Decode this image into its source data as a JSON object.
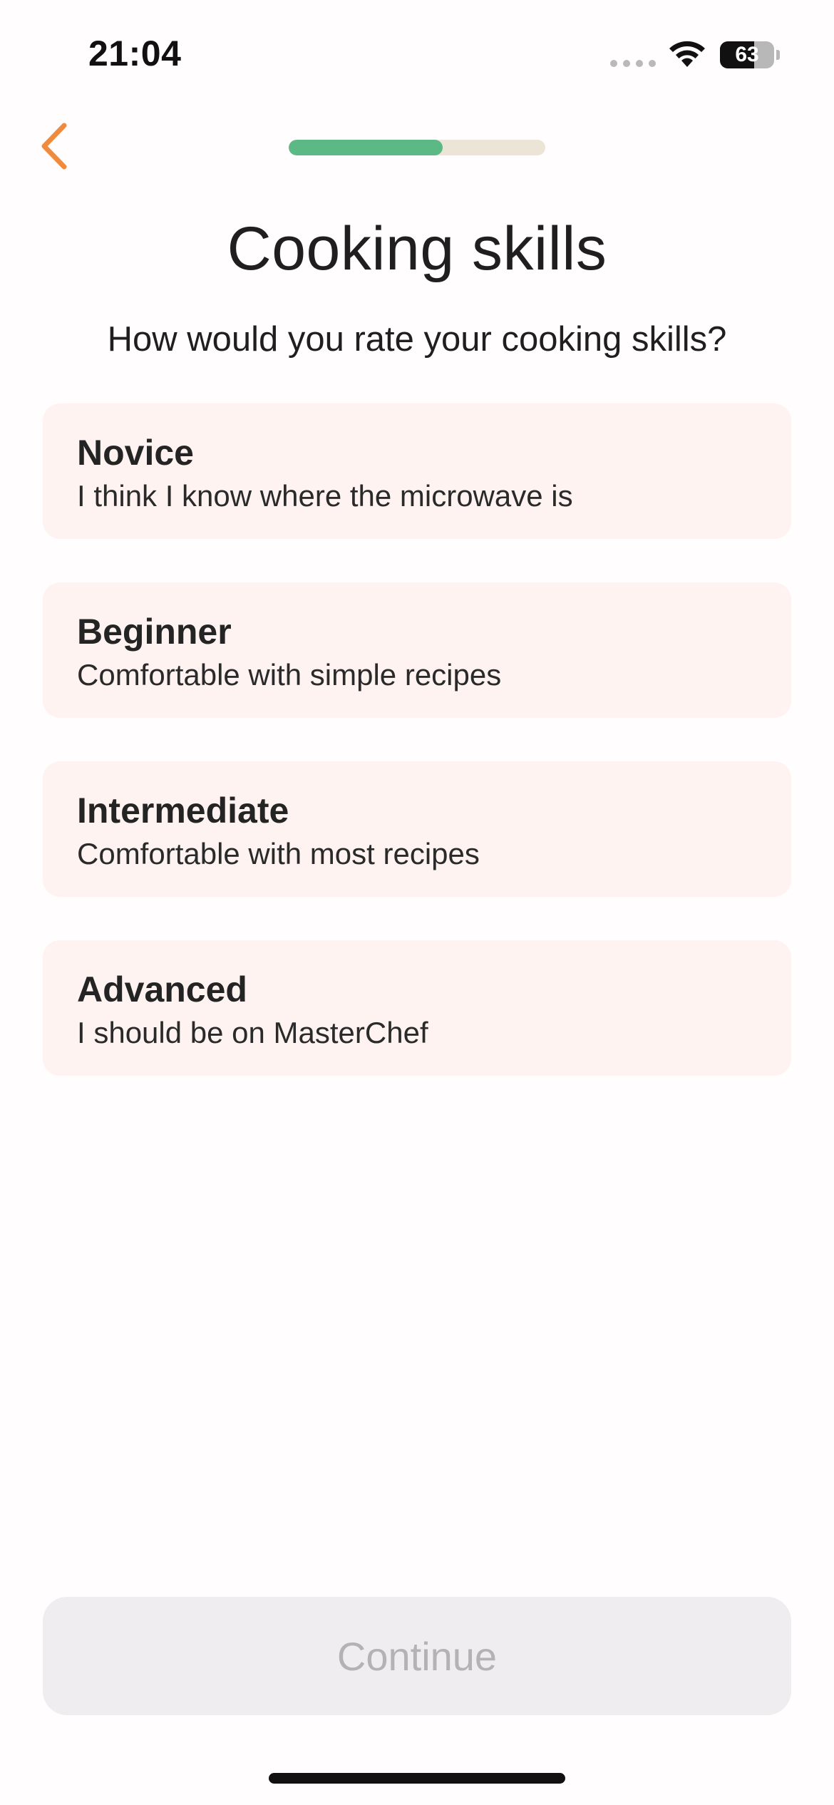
{
  "status_bar": {
    "time": "21:04",
    "battery_level": "63"
  },
  "nav": {
    "back_icon": "chevron-left-icon",
    "progress_fraction": 0.6
  },
  "header": {
    "title": "Cooking skills",
    "subtitle": "How would you rate your cooking skills?"
  },
  "options": [
    {
      "title": "Novice",
      "description": "I think I know where the microwave is"
    },
    {
      "title": "Beginner",
      "description": "Comfortable with simple recipes"
    },
    {
      "title": "Intermediate",
      "description": "Comfortable with most recipes"
    },
    {
      "title": "Advanced",
      "description": "I should be on MasterChef"
    }
  ],
  "footer": {
    "continue_label": "Continue"
  },
  "colors": {
    "accent": "#f08a3c",
    "progress": "#5cb985",
    "progress_track": "#ebe4d7",
    "card_background": "#fef3f0",
    "disabled_button": "#efedef",
    "disabled_text": "#b3b3b5"
  }
}
